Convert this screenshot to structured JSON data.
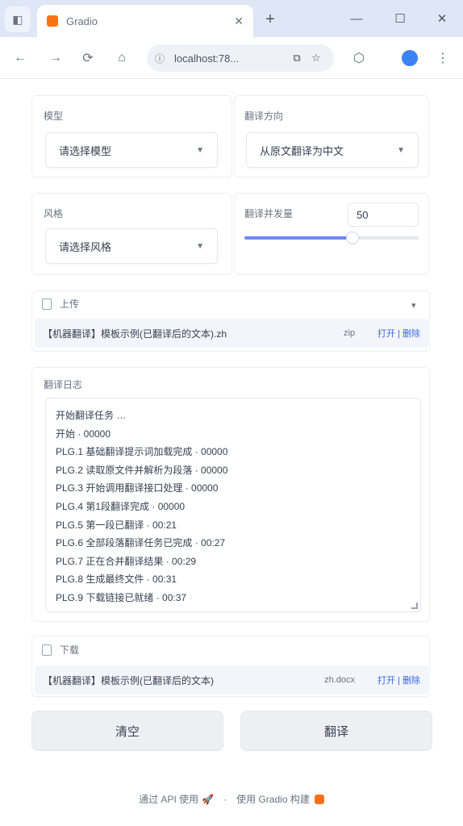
{
  "browser": {
    "tab_title": "Gradio",
    "url": "localhost:78...",
    "back_icon": "arrow-left-icon",
    "forward_icon": "arrow-right-icon",
    "reload_icon": "reload-icon",
    "home_icon": "home-icon",
    "new_tab": "+",
    "close": "✕",
    "minimize": "—",
    "maximize": "☐"
  },
  "form": {
    "model_label": "模型",
    "model_value": "请选择模型",
    "output_label": "翻译方向",
    "output_value": "从原文翻译为中文",
    "prompt_label": "风格",
    "prompt_value": "请选择风格",
    "slider_label": "翻译并发量",
    "slider_value": "50",
    "slider_fraction": 0.62
  },
  "upload": {
    "label": "上传",
    "file_name": "【机器翻译】模板示例(已翻译后的文本).zh",
    "file_size": "zip",
    "file_link": "打开 | 删除",
    "collapse": "▾"
  },
  "log": {
    "label": "翻译日志",
    "lines": [
      "开始翻译任务 …",
      "开始 · 00000",
      "PLG.1 基础翻译提示词加载完成 · 00000",
      "PLG.2 读取原文件并解析为段落 · 00000",
      "PLG.3 开始调用翻译接口处理 · 00000",
      "PLG.4 第1段翻译完成 · 00000",
      "PLG.5 第一段已翻译 · 00:21",
      "PLG.6 全部段落翻译任务已完成 · 00:27",
      "PLG.7 正在合并翻译结果 · 00:29",
      "PLG.8 生成最终文件 · 00:31",
      "PLG.9 下载链接已就绪 · 00:37"
    ]
  },
  "download": {
    "label": "下载",
    "file_name": "【机器翻译】模板示例(已翻译后的文本)",
    "file_size": "zh.docx",
    "file_link": "打开 | 删除"
  },
  "buttons": {
    "clear": "清空",
    "submit": "翻译"
  },
  "footer": {
    "api_text": "通过 API 使用",
    "built_text": "使用 Gradio 构建"
  }
}
